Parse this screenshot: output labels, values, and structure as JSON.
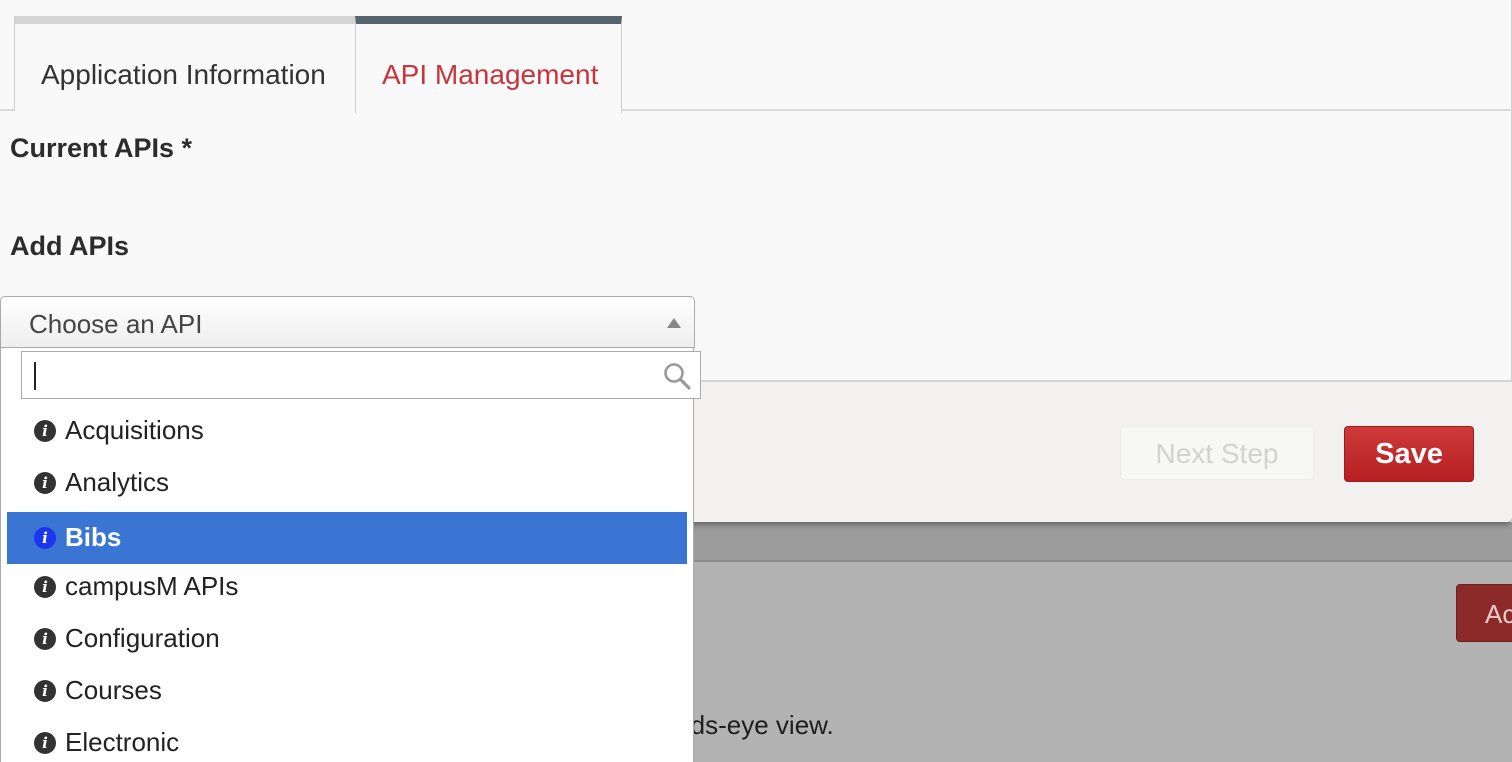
{
  "tabs": [
    {
      "label": "Application Information",
      "active": false
    },
    {
      "label": "API Management",
      "active": true
    }
  ],
  "sections": {
    "current_apis": "Current APIs *",
    "add_apis": "Add APIs"
  },
  "select": {
    "placeholder": "Choose an API",
    "search_value": ""
  },
  "options": [
    {
      "label": "Acquisitions",
      "icon": "info-icon"
    },
    {
      "label": "Analytics",
      "icon": "info-icon"
    },
    {
      "label": "Bibs",
      "icon": "info-icon",
      "highlighted": true
    },
    {
      "label": "campusM APIs",
      "icon": "info-icon"
    },
    {
      "label": "Configuration",
      "icon": "info-icon"
    },
    {
      "label": "Courses",
      "icon": "info-icon"
    },
    {
      "label": "Electronic",
      "icon": "info-icon"
    }
  ],
  "buttons": {
    "next_step": "Next Step",
    "save": "Save"
  },
  "background": {
    "add_button_partial": "Ac",
    "text_partial": "rds-eye view."
  },
  "colors": {
    "active_tab_text": "#c7353c",
    "active_tab_border": "#56656b",
    "highlight": "#3b75d4",
    "save_button": "#c12c2f"
  }
}
